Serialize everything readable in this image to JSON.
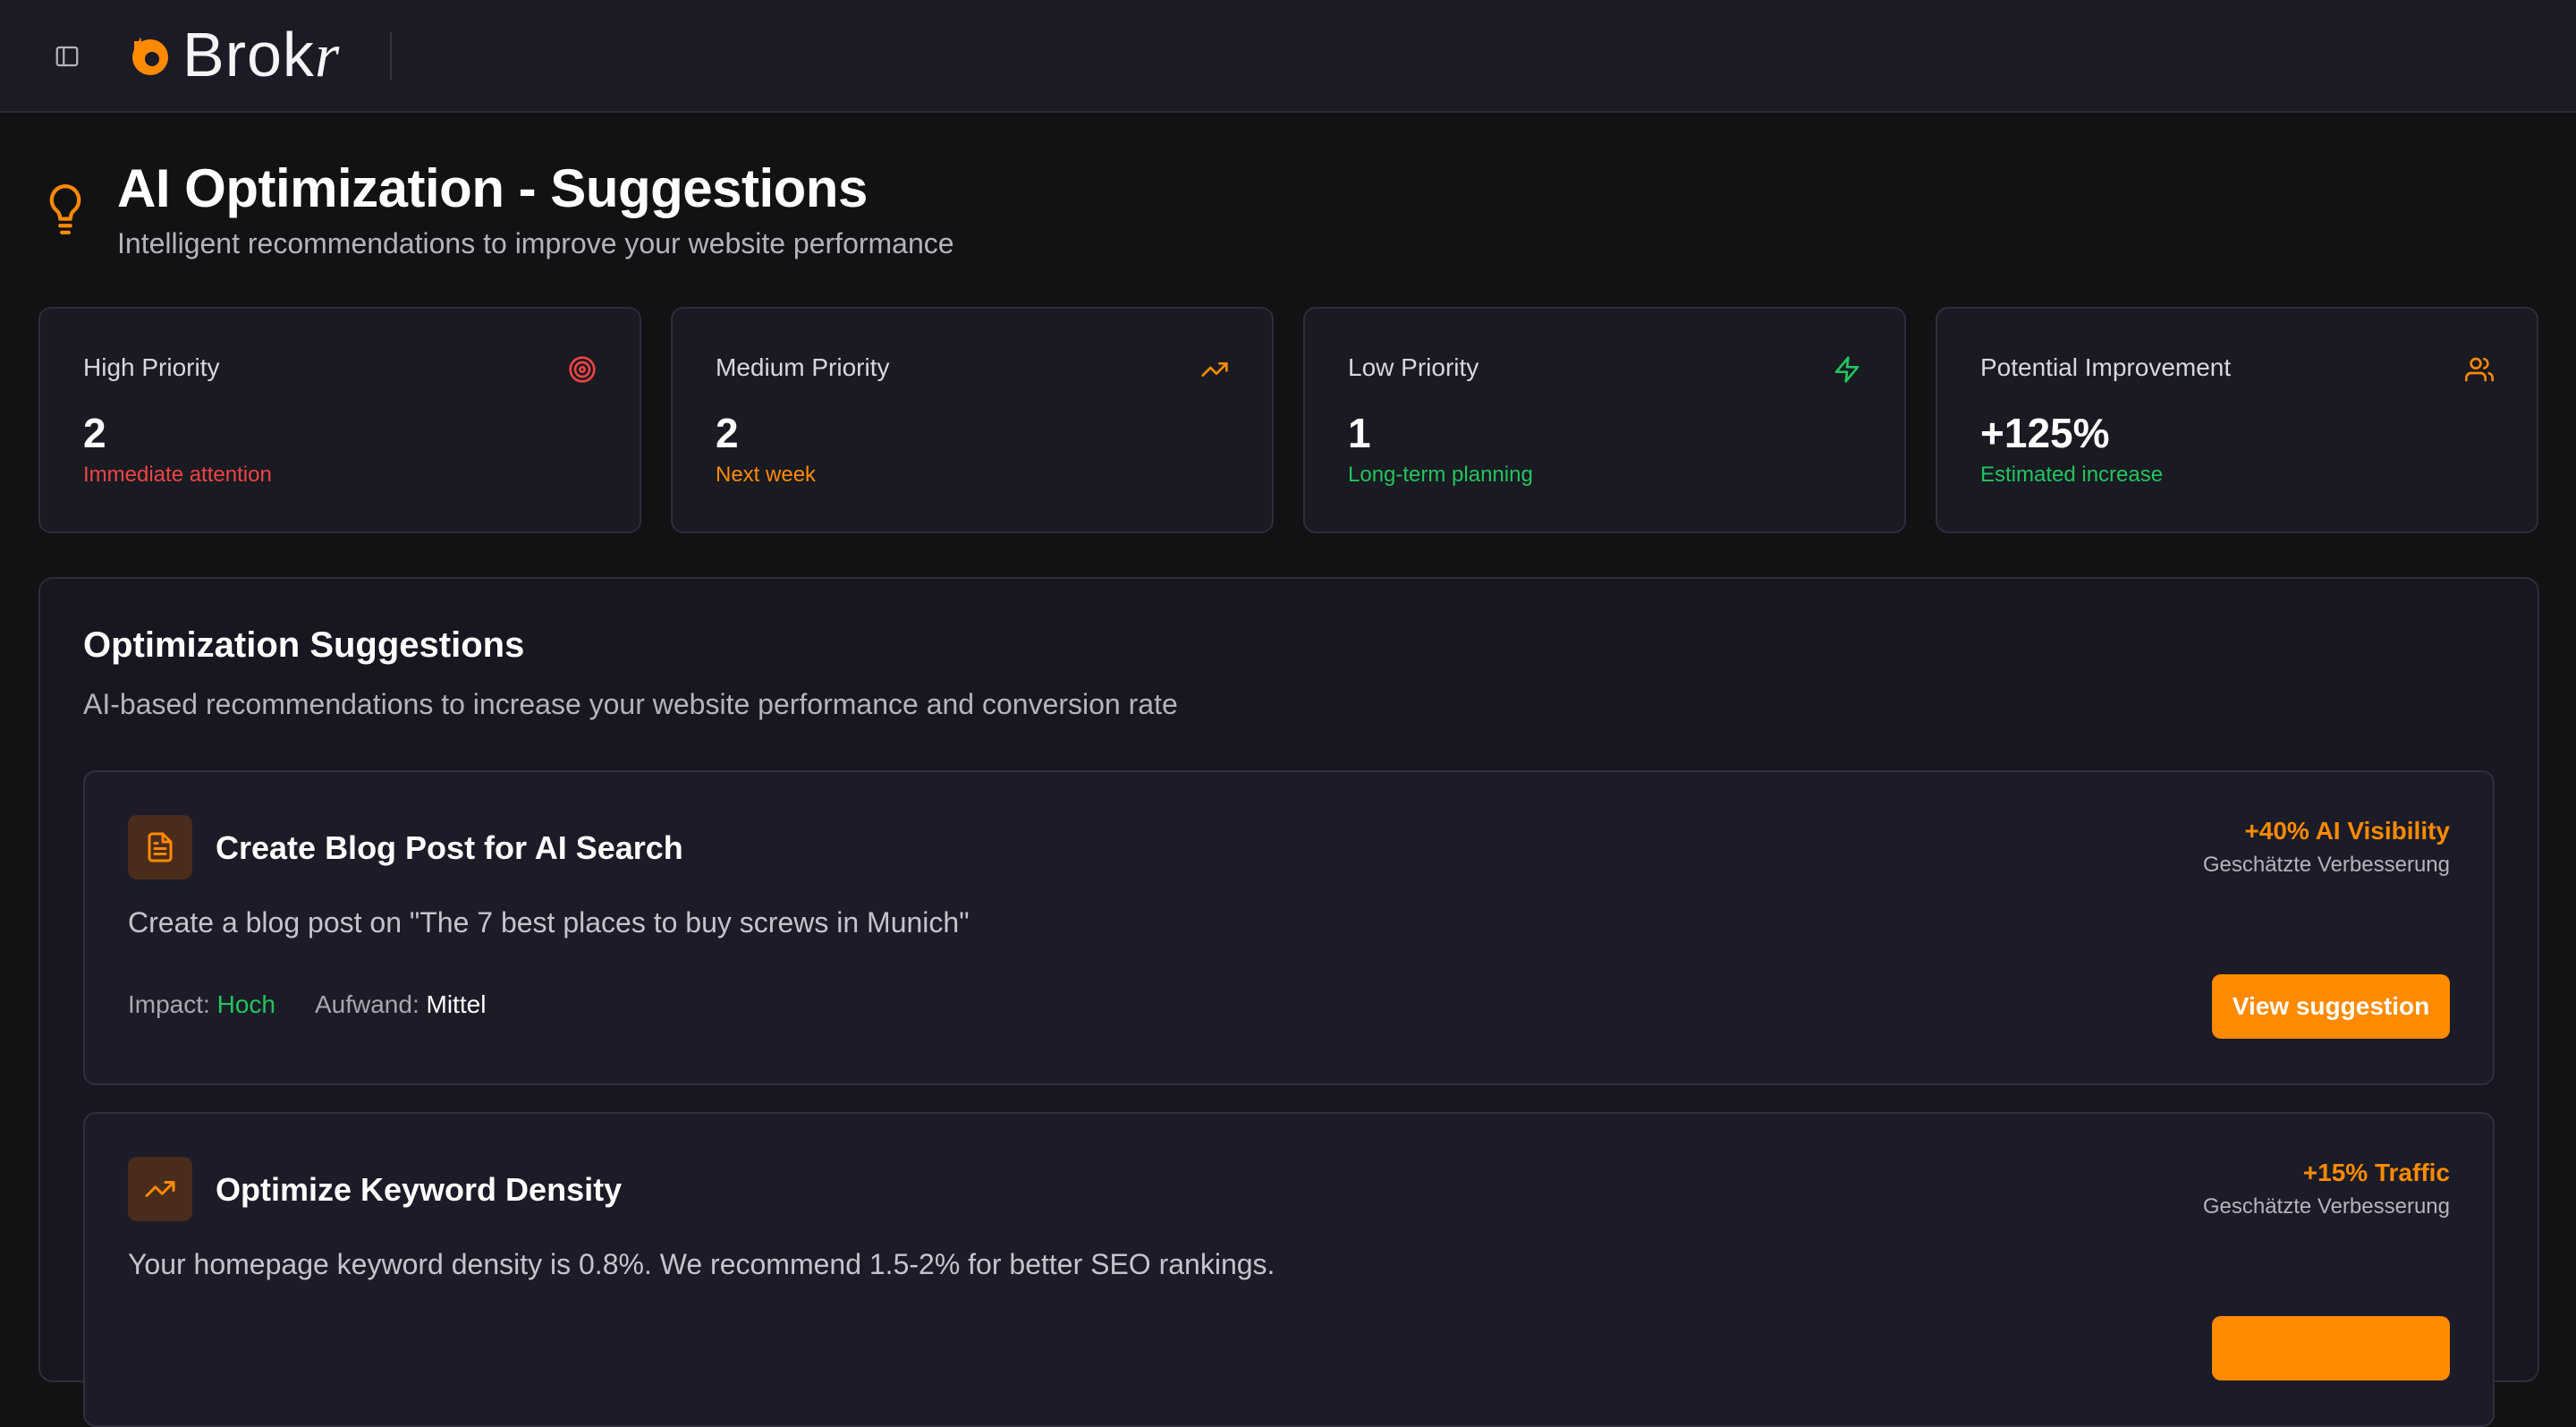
{
  "app": {
    "brand": "Brok",
    "brand_suffix": "r"
  },
  "header": {
    "title": "AI Optimization - Suggestions",
    "subtitle": "Intelligent recommendations to improve your website performance",
    "icon": "lightbulb-icon"
  },
  "stats": [
    {
      "label": "High Priority",
      "value": "2",
      "caption": "Immediate attention",
      "icon": "target-icon",
      "color": "#ef4444"
    },
    {
      "label": "Medium Priority",
      "value": "2",
      "caption": "Next week",
      "icon": "trending-up-icon",
      "color": "#ff8a00"
    },
    {
      "label": "Low Priority",
      "value": "1",
      "caption": "Long-term planning",
      "icon": "zap-icon",
      "color": "#22c55e"
    },
    {
      "label": "Potential Improvement",
      "value": "+125%",
      "caption": "Estimated increase",
      "icon": "users-icon",
      "color": "#22c55e",
      "icon_color": "#ff8a00"
    }
  ],
  "panel": {
    "title": "Optimization Suggestions",
    "subtitle": "AI-based recommendations to increase your website performance and conversion rate"
  },
  "suggestions": [
    {
      "icon": "document-icon",
      "title": "Create Blog Post for AI Search",
      "metric": "+40% AI Visibility",
      "metric_caption": "Geschätzte Verbesserung",
      "description": "Create a blog post on \"The 7 best places to buy screws in Munich\"",
      "impact_label": "Impact:",
      "impact_value": "Hoch",
      "effort_label": "Aufwand:",
      "effort_value": "Mittel",
      "button_label": "View suggestion"
    },
    {
      "icon": "trending-up-icon",
      "title": "Optimize Keyword Density",
      "metric": "+15% Traffic",
      "metric_caption": "Geschätzte Verbesserung",
      "description": "Your homepage keyword density is 0.8%. We recommend 1.5-2% for better SEO rankings."
    }
  ],
  "colors": {
    "accent": "#ff8a00",
    "danger": "#ef4444",
    "success": "#22c55e",
    "background": "#121215",
    "topbar": "#1a1b25"
  }
}
